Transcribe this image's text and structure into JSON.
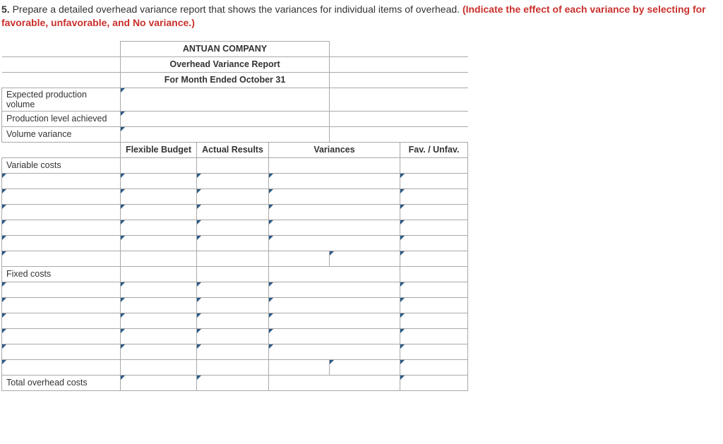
{
  "question": {
    "number": "5.",
    "text": "Prepare a detailed overhead variance report that shows the variances for individual items of overhead. ",
    "hint": "(Indicate the effect of each variance by selecting  for favorable, unfavorable, and No variance.)"
  },
  "header": {
    "company": "ANTUAN COMPANY",
    "title": "Overhead Variance Report",
    "period": "For Month Ended October 31"
  },
  "top_rows": {
    "expected_label": "Expected production volume",
    "achieved_label": "Production level achieved",
    "volume_label": "Volume variance",
    "expected_value": "",
    "achieved_value": "",
    "volume_value": ""
  },
  "col_headers": {
    "flex": "Flexible Budget",
    "actual": "Actual Results",
    "var": "Variances",
    "fav": "Fav. / Unfav."
  },
  "sections": {
    "variable": "Variable costs",
    "fixed": "Fixed costs",
    "total": "Total overhead costs"
  }
}
